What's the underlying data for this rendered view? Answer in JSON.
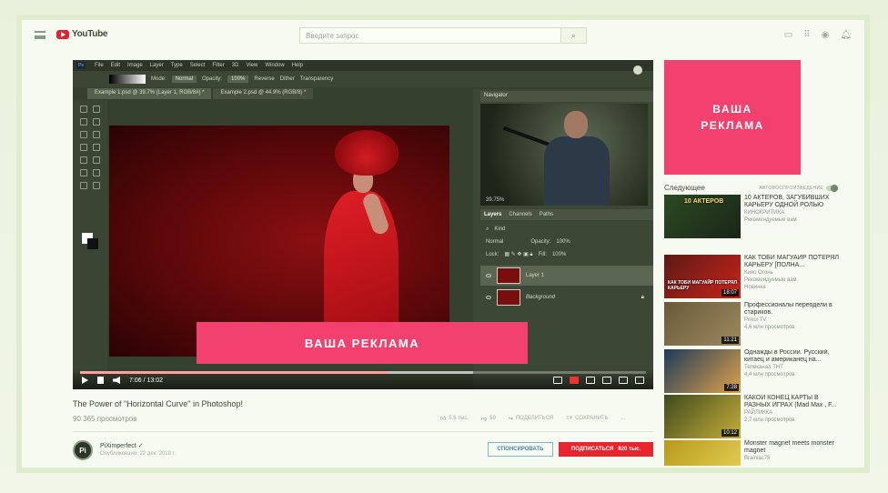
{
  "header": {
    "logo": "YouTube",
    "search_placeholder": "Введите запрос",
    "icons": [
      "upload-icon",
      "apps-icon",
      "messages-icon",
      "notifications-icon"
    ]
  },
  "video": {
    "photoshop": {
      "menu": [
        "File",
        "Edit",
        "Image",
        "Layer",
        "Type",
        "Select",
        "Filter",
        "3D",
        "View",
        "Window",
        "Help"
      ],
      "options": {
        "mode_label": "Mode:",
        "mode_value": "Normal",
        "opacity_label": "Opacity:",
        "opacity_value": "100%",
        "reverse": "Reverse",
        "dither": "Dither",
        "transparency": "Transparency"
      },
      "tabs": [
        "Example 1.psd @ 39.7% (Layer 1, RGB/8#) *",
        "Example 2.psd @ 44.9% (RGB/8) *"
      ],
      "navigator": {
        "title": "Navigator",
        "zoom": "39.75%"
      },
      "layers_panel": {
        "tabs": [
          "Layers",
          "Channels",
          "Paths"
        ],
        "kind": "Kind",
        "blend": "Normal",
        "opacity_label": "Opacity:",
        "opacity": "100%",
        "lock_label": "Lock:",
        "fill_label": "Fill:",
        "fill": "100%",
        "layers": [
          "Layer 1",
          "Background"
        ]
      }
    },
    "ad_text": "ВАША РЕКЛАМА",
    "time": "7:06 / 13:02",
    "progress": 0.545
  },
  "info": {
    "title": "The Power of \"Horizontal Curve\" in Photoshop!",
    "views": "90 365 просмотров",
    "likes": "5,6 тыс.",
    "dislikes": "59",
    "share": "ПОДЕЛИТЬСЯ",
    "save": "СОХРАНИТЬ",
    "more": "..."
  },
  "channel": {
    "avatar": "Pi",
    "name": "PiXimperfect",
    "date": "Опубликовано: 22 дек. 2018 г.",
    "sponsor_label": "СПОНСИРОВАТЬ",
    "subscribe_label": "ПОДПИСАТЬСЯ",
    "subscribers": "820 тыс."
  },
  "sidebar": {
    "ad_line1": "ВАША",
    "ad_line2": "РЕКЛАМА",
    "up_next": "Следующее",
    "autoplay": "АВТОВОСПРОИЗВЕДЕНИЕ",
    "items": [
      {
        "title": "10 АКТЕРОВ, ЗАГУБИВШИХ КАРЬЕРУ ОДНОЙ РОЛЬЮ",
        "channel": "КИНОКРИТИКА",
        "meta": "Рекомендуемые вам",
        "duration": "",
        "thumb_text": "10 АКТЕРОВ"
      },
      {
        "title": "КАК ТОБИ МАГУАЙР ПОТЕРЯЛ КАРЬЕРУ [ПОЛНА...",
        "channel": "Кино Огонь",
        "meta": "Рекомендуемые вам",
        "badge": "Новинка",
        "duration": "18:07",
        "thumb_text": "КАК ТОБИ МАГУАЙР ПОТЕРЯЛ КАРЬЕРУ"
      },
      {
        "title": "Профессионалы переодели в стариков.",
        "channel": "Prikol TV",
        "meta": "4,6 млн просмотров",
        "duration": "11:21",
        "thumb_text": ""
      },
      {
        "title": "Однажды в России. Русский, китаец и американец на...",
        "channel": "Телеканал ТНТ",
        "meta": "4,4 млн просмотров",
        "duration": "7:28",
        "thumb_text": ""
      },
      {
        "title": "КАКОЙ КОНЕЦ КАРТЫ В РАЗНЫХ ИГРАХ (Mad Max , F...",
        "channel": "РАЙЛИККА",
        "meta": "2,7 млн просмотров",
        "duration": "10:12",
        "thumb_text": ""
      },
      {
        "title": "Monster magnet meets monster magnet",
        "channel": "Brainiac75",
        "meta": "",
        "duration": "",
        "thumb_text": ""
      }
    ]
  },
  "colors": {
    "accent": "#f2416f",
    "subscribe": "#e9242c",
    "brand": "#e0242f"
  }
}
